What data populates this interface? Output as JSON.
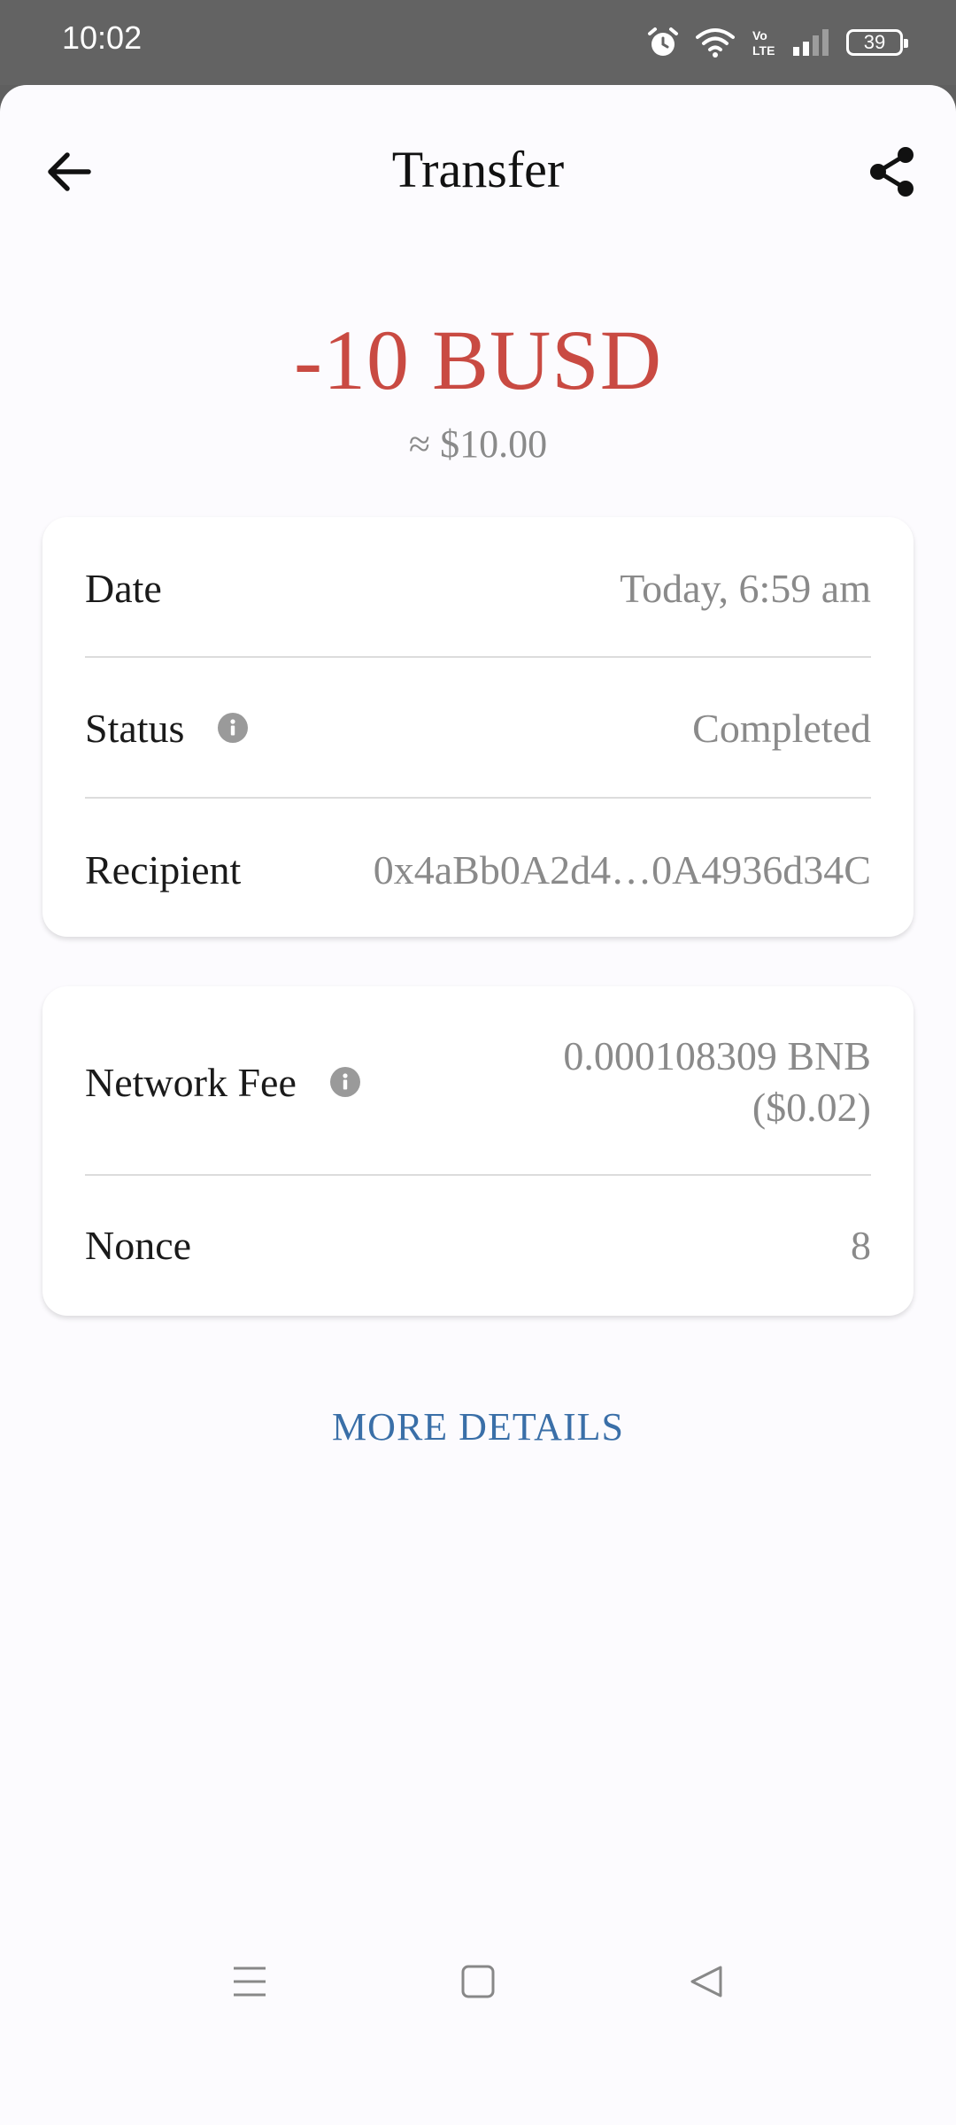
{
  "status_bar": {
    "time": "10:02",
    "battery": "39",
    "icons": [
      "alarm-icon",
      "wifi-icon",
      "volte-icon",
      "signal-icon",
      "battery-icon"
    ]
  },
  "header": {
    "title": "Transfer",
    "back_icon": "arrow-left-icon",
    "share_icon": "share-icon"
  },
  "summary": {
    "amount": "-10 BUSD",
    "fiat": "≈ $10.00",
    "amount_color": "#c94a42"
  },
  "details": {
    "date_label": "Date",
    "date_value": "Today, 6:59 am",
    "status_label": "Status",
    "status_value": "Completed",
    "recipient_label": "Recipient",
    "recipient_value": "0x4aBb0A2d4…0A4936d34C"
  },
  "fees": {
    "fee_label": "Network Fee",
    "fee_value": "0.000108309 BNB",
    "fee_fiat": "($0.02)",
    "nonce_label": "Nonce",
    "nonce_value": "8"
  },
  "actions": {
    "more_details": "MORE DETAILS",
    "link_color": "#3a6fa8"
  },
  "navigation": {
    "items": [
      "menu-icon",
      "home-icon",
      "back-icon"
    ]
  }
}
